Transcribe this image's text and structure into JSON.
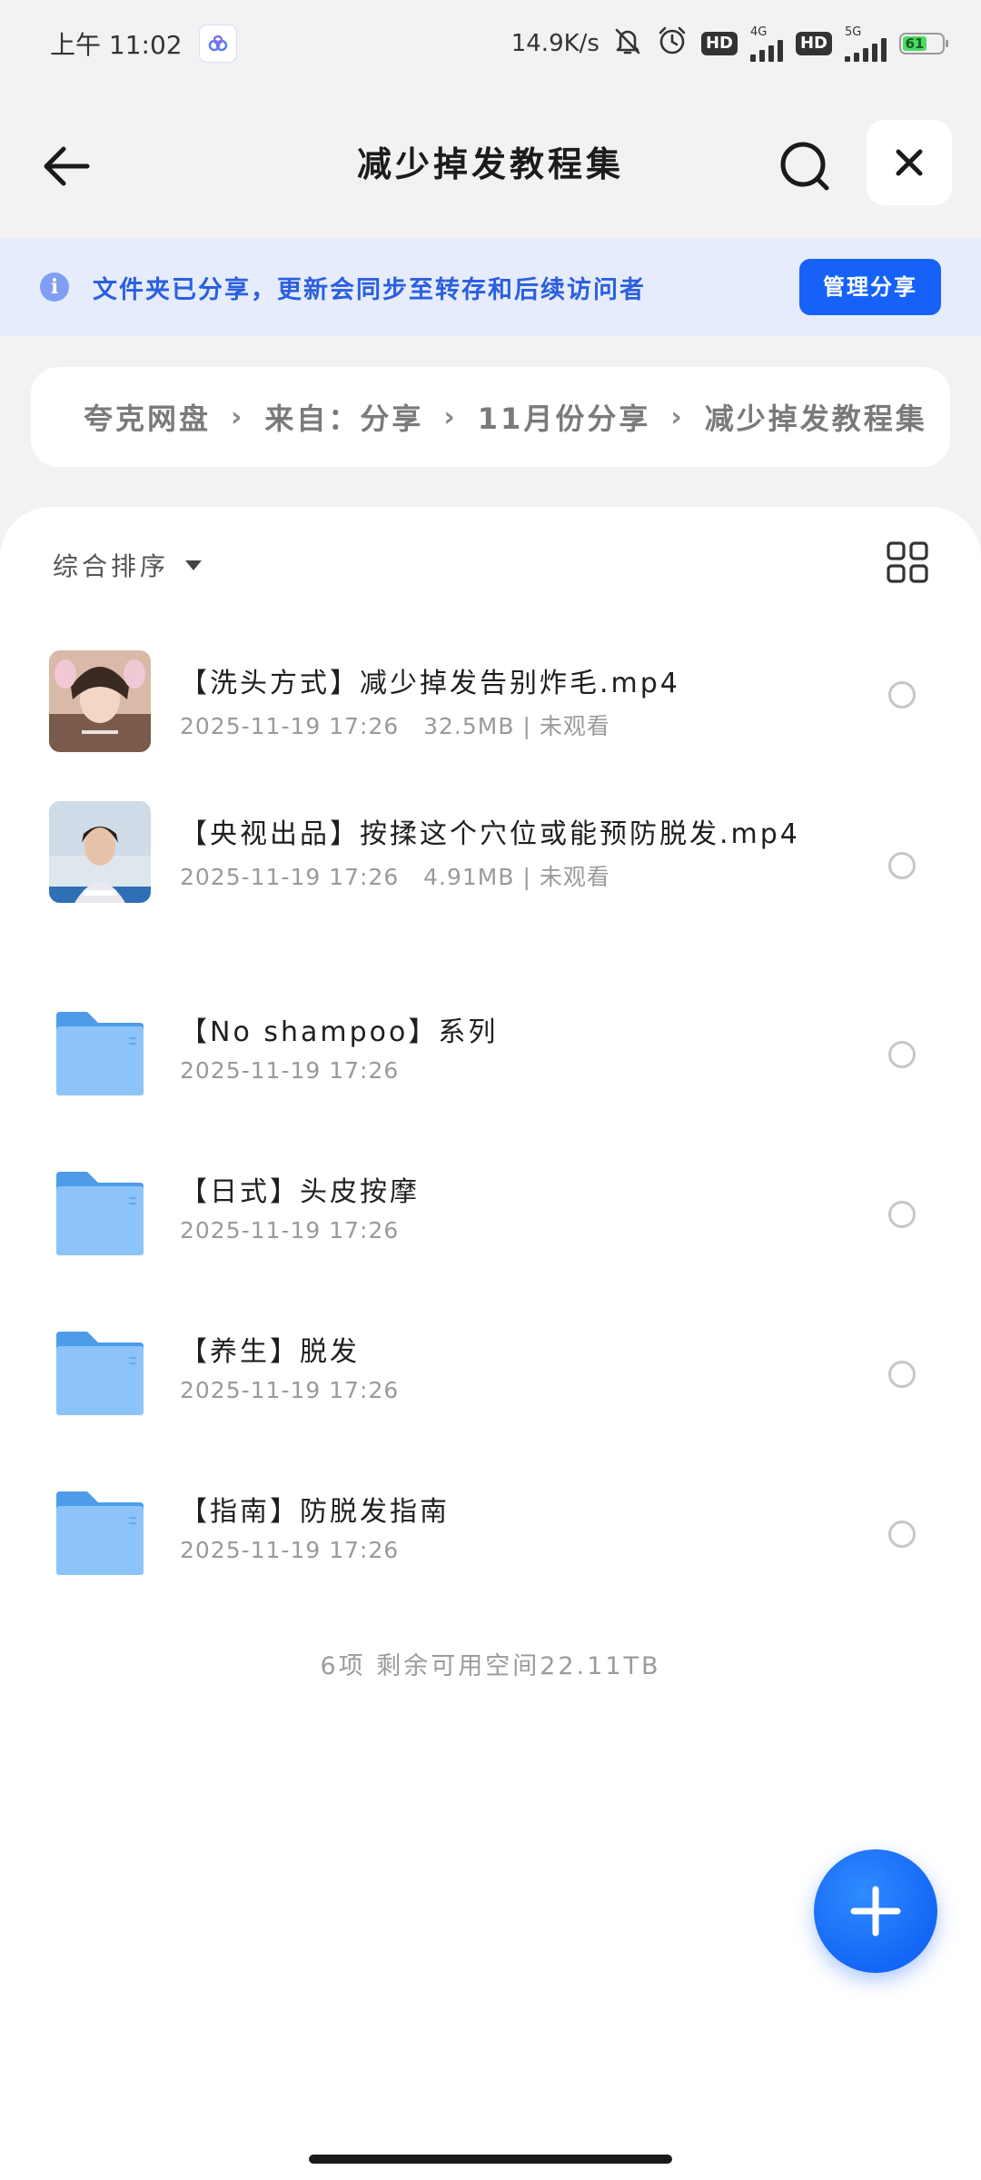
{
  "status_bar": {
    "time": "上午 11:02",
    "network_speed": "14.9K/s",
    "hd1": "HD",
    "net1": "4G",
    "hd2": "HD",
    "net2": "5G",
    "battery": "61",
    "icons": [
      "mute-bell-icon",
      "alarm-icon",
      "signal-icon",
      "battery-icon"
    ]
  },
  "header": {
    "title": "减少掉发教程集",
    "back_icon": "arrow-left-icon",
    "search_icon": "search-icon",
    "close_icon": "close-icon"
  },
  "banner": {
    "text": "文件夹已分享，更新会同步至转存和后续访问者",
    "button": "管理分享",
    "icon": "info-icon"
  },
  "breadcrumb": [
    "夸克网盘",
    "来自：分享",
    "11月份分享",
    "减少掉发教程集"
  ],
  "toolbar": {
    "sort_label": "综合排序",
    "view_icon": "grid-view-icon"
  },
  "files": [
    {
      "name": "【洗头方式】减少掉发告别炸毛.mp4",
      "date": "2025-11-19 17:26",
      "size": "32.5MB",
      "status": "未观看",
      "type": "video"
    },
    {
      "name": "【央视出品】按揉这个穴位或能预防脱发.mp4",
      "date": "2025-11-19 17:26",
      "size": "4.91MB",
      "status": "未观看",
      "type": "video"
    },
    {
      "name": "【No shampoo】系列",
      "date": "2025-11-19 17:26",
      "type": "folder"
    },
    {
      "name": "【日式】头皮按摩",
      "date": "2025-11-19 17:26",
      "type": "folder"
    },
    {
      "name": "【养生】脱发",
      "date": "2025-11-19 17:26",
      "type": "folder"
    },
    {
      "name": "【指南】防脱发指南",
      "date": "2025-11-19 17:26",
      "type": "folder"
    }
  ],
  "summary": "6项  剩余可用空间22.11TB",
  "colors": {
    "accent": "#1662f8",
    "banner_bg": "#e6ecfb",
    "banner_text": "#2b5fe0",
    "folder": "#6fb1f6"
  }
}
